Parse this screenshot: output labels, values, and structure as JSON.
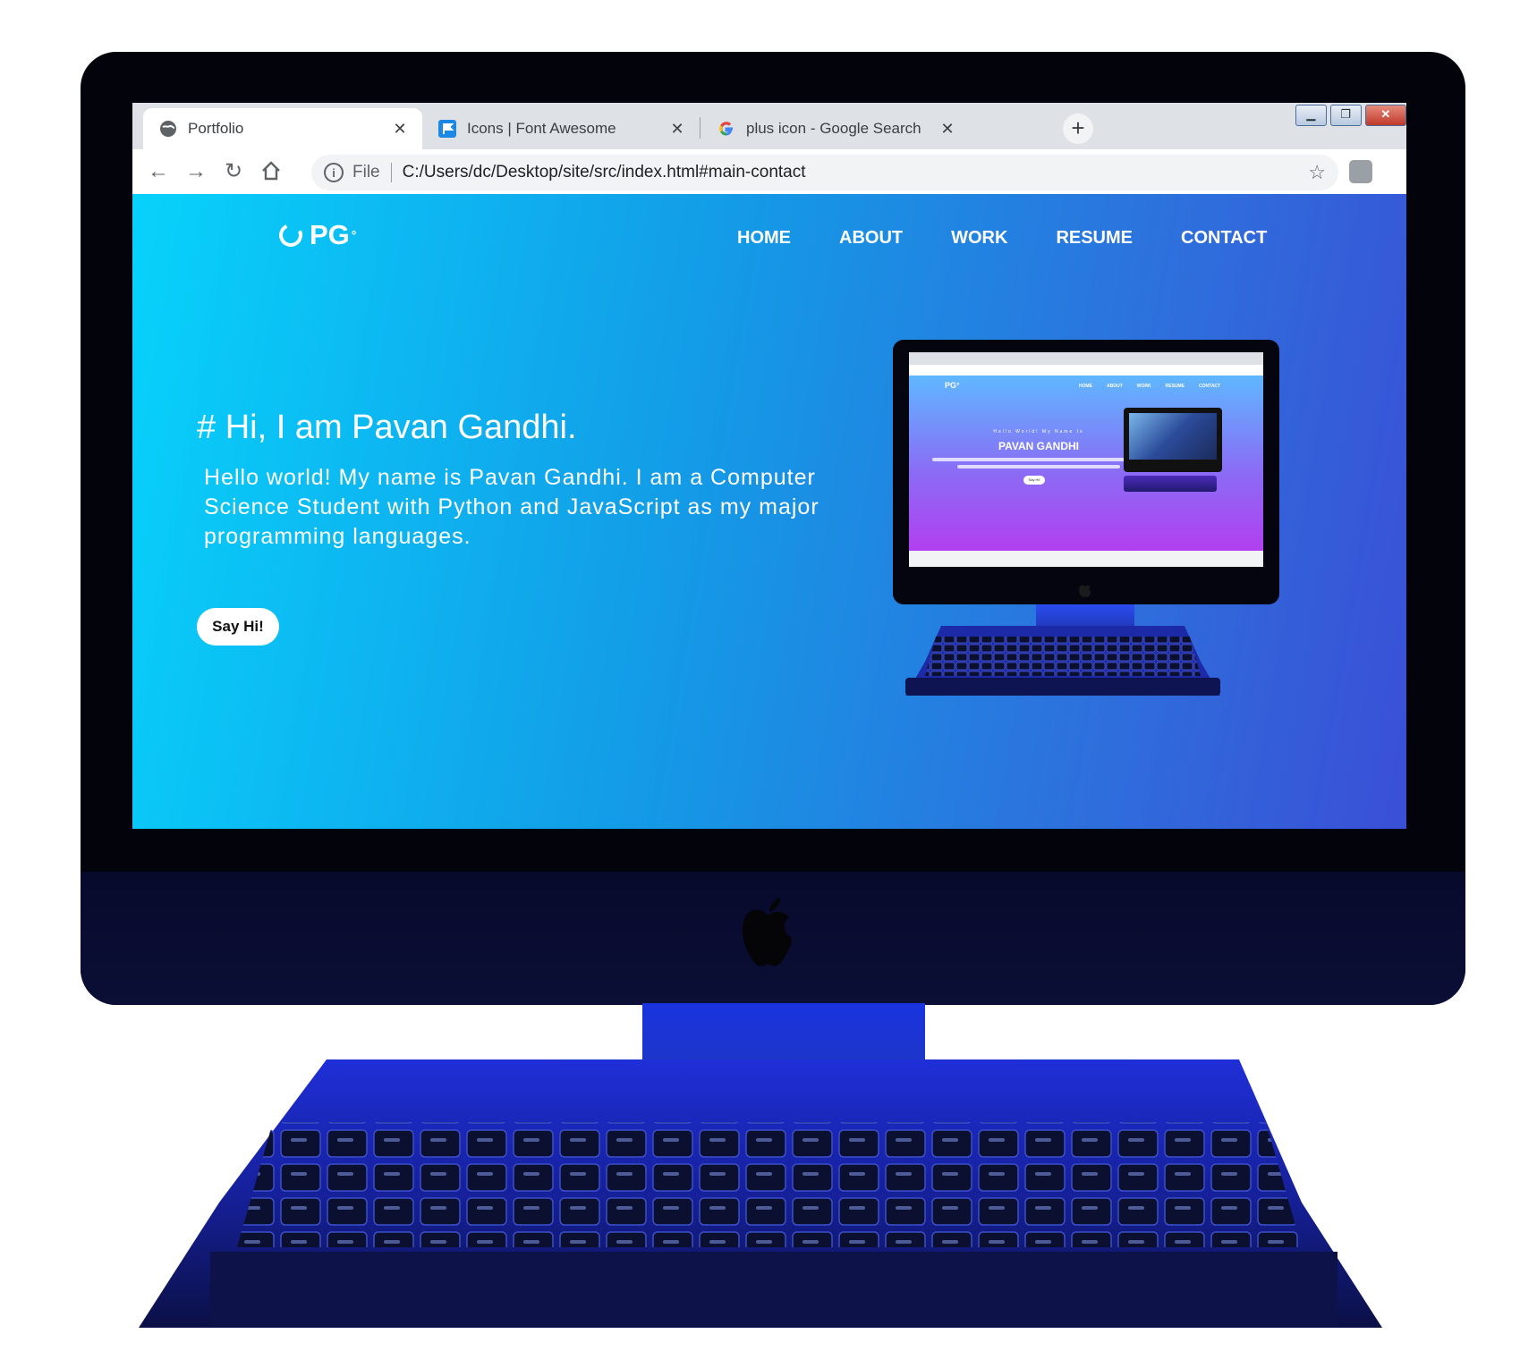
{
  "browser": {
    "tabs": [
      {
        "title": "Portfolio",
        "icon": "globe-icon",
        "active": true
      },
      {
        "title": "Icons | Font Awesome",
        "icon": "flag-icon",
        "active": false
      },
      {
        "title": "plus icon - Google Search",
        "icon": "google-icon",
        "active": false
      }
    ],
    "new_tab_label": "+",
    "address": {
      "scheme": "File",
      "url": "C:/Users/dc/Desktop/site/src/index.html#main-contact"
    },
    "window_controls": {
      "minimize": "▁",
      "restore": "❐",
      "close": "✕"
    },
    "colors": {
      "tab_strip": "#dee1e6",
      "toolbar": "#ffffff",
      "grammarly": "#15c39a"
    }
  },
  "site": {
    "logo": {
      "text": "PG",
      "mark": "°"
    },
    "nav": [
      "HOME",
      "ABOUT",
      "WORK",
      "RESUME",
      "CONTACT"
    ],
    "hero": {
      "title": "# Hi, I am Pavan Gandhi.",
      "text": "Hello world! My name is Pavan Gandhi. I am a Computer Science Student with Python and JavaScript as my major programming languages.",
      "button": "Say Hi!"
    },
    "colors": {
      "gradient_start": "#07d2fb",
      "gradient_end": "#3a4fd6"
    }
  },
  "mini_site": {
    "logo": "PG°",
    "nav": [
      "HOME",
      "ABOUT",
      "WORK",
      "RESUME",
      "CONTACT"
    ],
    "small": "Hello World! My Name Is",
    "name": "PAVAN GANDHI",
    "button": "Say Hi!"
  }
}
